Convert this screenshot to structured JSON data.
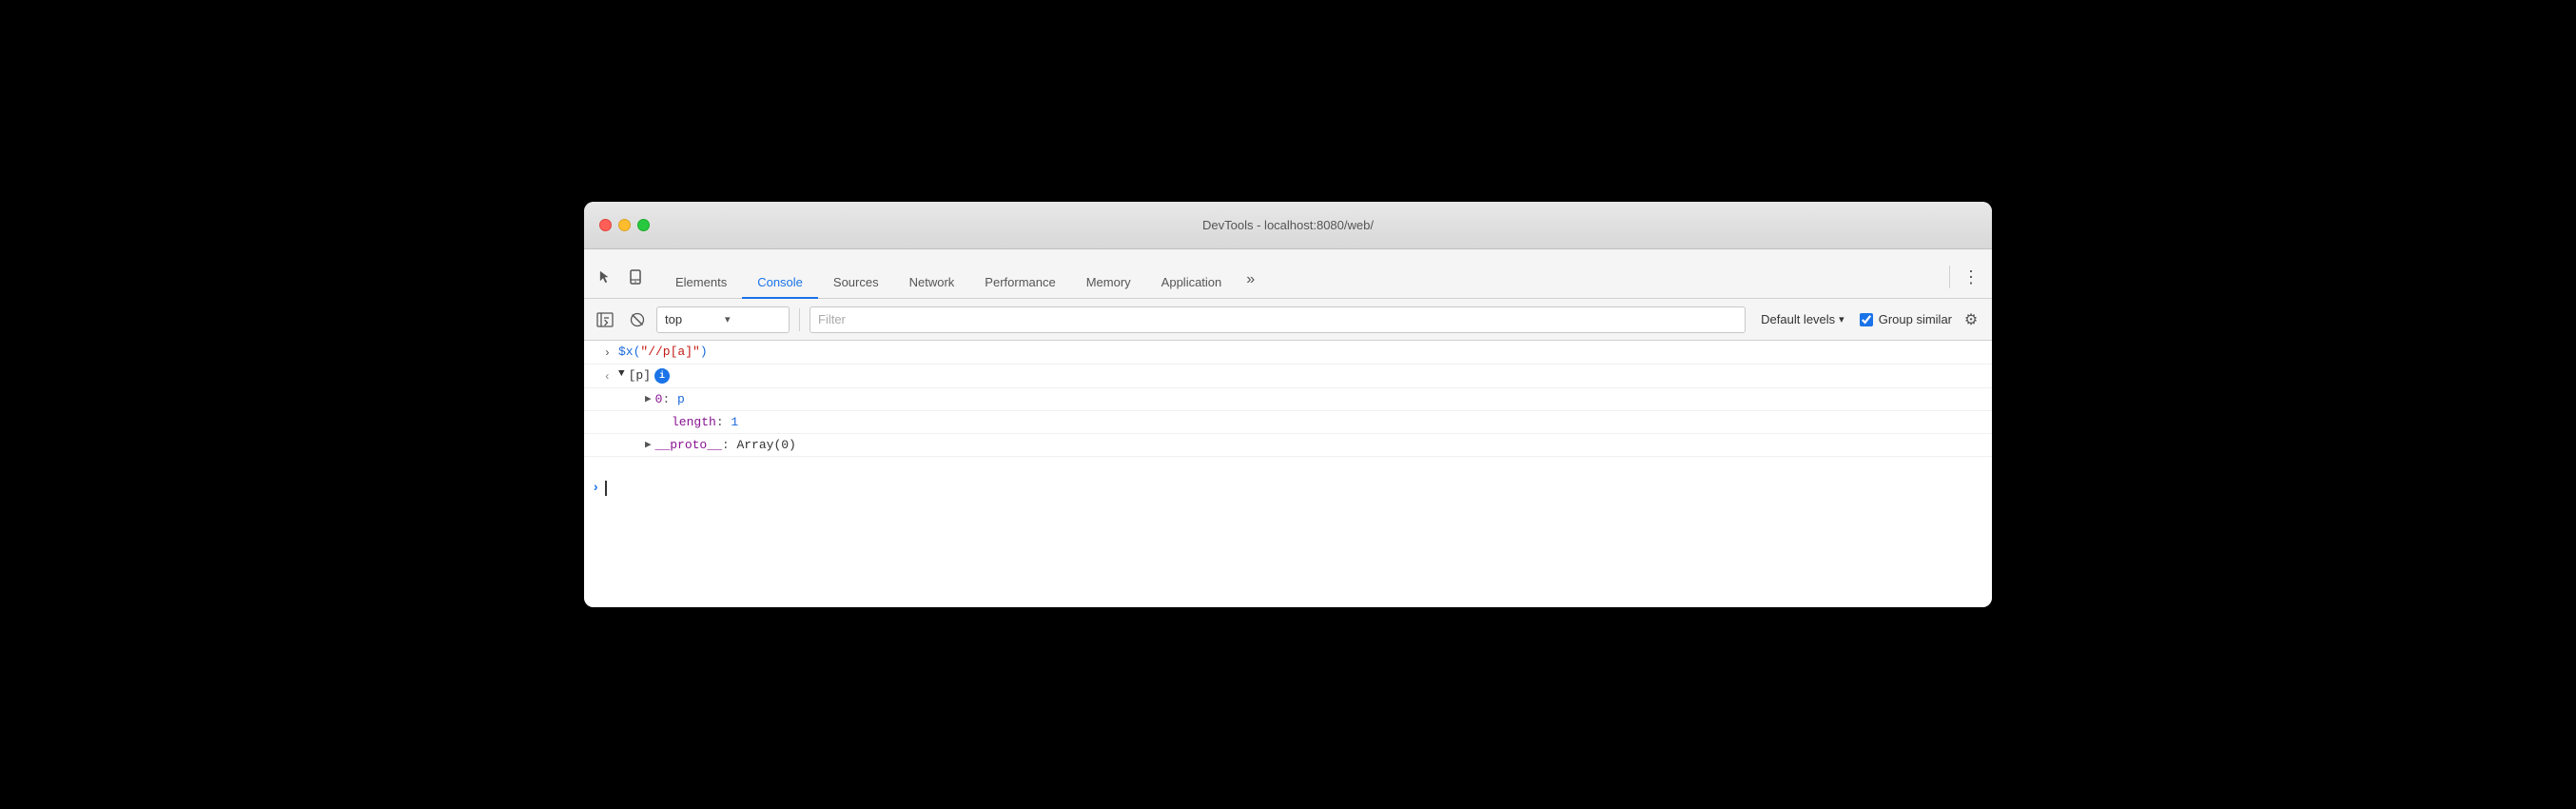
{
  "window": {
    "title": "DevTools - localhost:8080/web/",
    "traffic_lights": {
      "close": "close",
      "minimize": "minimize",
      "maximize": "maximize"
    }
  },
  "tabbar": {
    "icons": [
      {
        "name": "cursor-icon",
        "symbol": "↖"
      },
      {
        "name": "mobile-icon",
        "symbol": "⬜"
      }
    ],
    "tabs": [
      {
        "id": "elements",
        "label": "Elements",
        "active": false
      },
      {
        "id": "console",
        "label": "Console",
        "active": true
      },
      {
        "id": "sources",
        "label": "Sources",
        "active": false
      },
      {
        "id": "network",
        "label": "Network",
        "active": false
      },
      {
        "id": "performance",
        "label": "Performance",
        "active": false
      },
      {
        "id": "memory",
        "label": "Memory",
        "active": false
      },
      {
        "id": "application",
        "label": "Application",
        "active": false
      }
    ],
    "more_label": "»",
    "menu_label": "⋮"
  },
  "toolbar": {
    "icons": [
      {
        "name": "sidebar-icon",
        "symbol": "▶|"
      },
      {
        "name": "block-icon",
        "symbol": "⊘"
      }
    ],
    "context": {
      "value": "top",
      "placeholder": "top"
    },
    "filter": {
      "placeholder": "Filter"
    },
    "levels_label": "Default levels",
    "group_similar_label": "Group similar",
    "group_similar_checked": true,
    "gear_symbol": "⚙"
  },
  "console": {
    "lines": [
      {
        "type": "input",
        "gutter": ">",
        "content": "$x(\"//p[a]\")"
      },
      {
        "type": "output_header",
        "gutter": "<",
        "arrow": "▼",
        "label": "[p]",
        "has_badge": true,
        "badge_text": "i"
      },
      {
        "type": "output_item",
        "indent": 1,
        "arrow": "▶",
        "key": "0",
        "value": "p",
        "key_color": "purple",
        "value_color": "blue"
      },
      {
        "type": "output_prop",
        "indent": 1,
        "key": "length",
        "value": "1",
        "key_color": "purple",
        "value_color": "blue"
      },
      {
        "type": "output_item",
        "indent": 1,
        "arrow": "▶",
        "key": "__proto__",
        "value": "Array(0)",
        "key_color": "purple",
        "value_color": "default"
      }
    ],
    "input_prompt": ">",
    "input_value": ""
  }
}
